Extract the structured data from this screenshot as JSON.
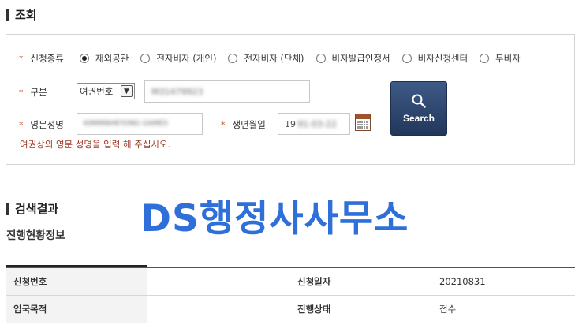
{
  "inquiry": {
    "heading": "조회"
  },
  "form": {
    "type_label": "신청종류",
    "required_mark": "*",
    "radio_options": [
      {
        "label": "재외공관",
        "checked": true
      },
      {
        "label": "전자비자 (개인)",
        "checked": false
      },
      {
        "label": "전자비자 (단체)",
        "checked": false
      },
      {
        "label": "비자발급인정서",
        "checked": false
      },
      {
        "label": "비자신청센터",
        "checked": false
      },
      {
        "label": "무비자",
        "checked": false
      }
    ],
    "category_label": "구분",
    "category_select_value": "여권번호",
    "passport_value": "M31479923",
    "name_label": "영문성명",
    "name_value": "KIMMINHEYONG GAMES",
    "birth_label": "생년월일",
    "birth_value_visible": "19",
    "birth_value_blurred": "91-03-22",
    "search_button_label": "Search",
    "hint": "여권상의 영문 성명을 입력 해 주십시오."
  },
  "watermark": "DS행정사사무소",
  "results": {
    "heading": "검색결과",
    "subtitle": "진행현황정보",
    "rows": [
      {
        "h1": "신청번호",
        "v1": "",
        "h2": "신청일자",
        "v2": "20210831"
      },
      {
        "h1": "입국목적",
        "v1": "",
        "h2": "진행상태",
        "v2": "접수"
      }
    ]
  },
  "colors": {
    "accent": "#2f6fd9",
    "button": "#2c4470",
    "required": "#d14b2a",
    "hint": "#9e3b27"
  }
}
